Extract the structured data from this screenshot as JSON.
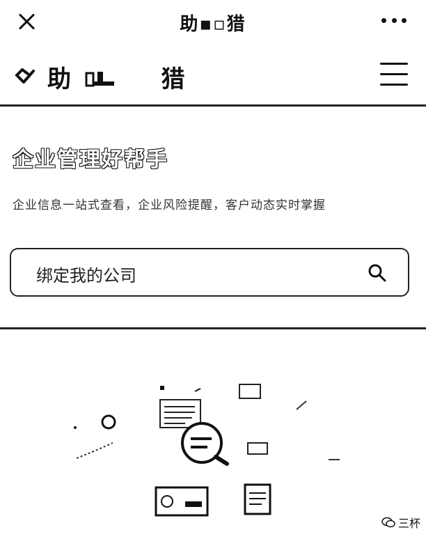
{
  "topbar": {
    "title": "助▪▫猎"
  },
  "header": {
    "brand_name_left": "助",
    "brand_name_right": "猎"
  },
  "hero": {
    "title": "企业管理好帮手",
    "subtitle": "企业信息一站式查看，企业风险提醒，客户动态实时掌握"
  },
  "search": {
    "placeholder": "绑定我的公司"
  },
  "watermark": {
    "text": "三杯"
  },
  "icons": {
    "close": "close-icon",
    "more": "more-icon",
    "logo": "logo-icon",
    "menu": "menu-icon",
    "search": "search-icon",
    "wechat": "wechat-icon"
  }
}
